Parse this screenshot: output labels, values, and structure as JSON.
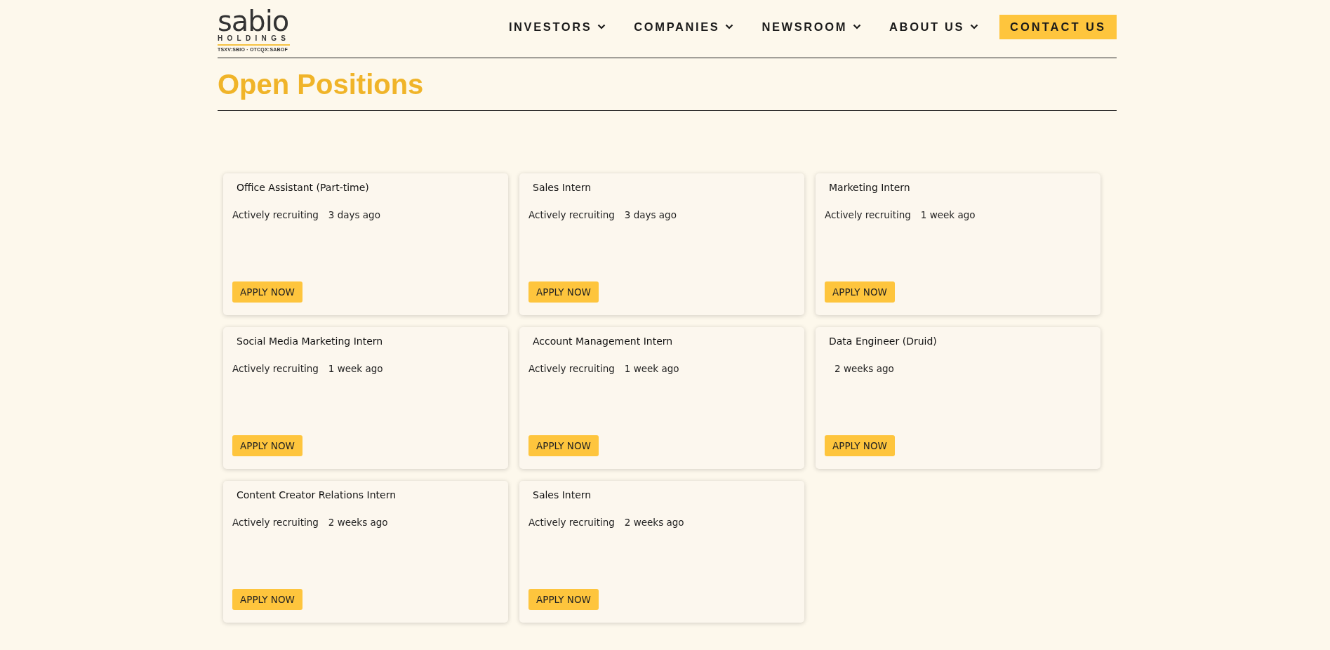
{
  "logo": {
    "name": "sabio",
    "sub": "HOLDINGS",
    "tickers": "TSXV:SBIO · OTCQX:SABOF"
  },
  "nav": [
    {
      "label": "INVESTORS",
      "kind": "dropdown"
    },
    {
      "label": "COMPANIES",
      "kind": "dropdown"
    },
    {
      "label": "NEWSROOM",
      "kind": "dropdown"
    },
    {
      "label": "ABOUT US",
      "kind": "dropdown"
    },
    {
      "label": "CONTACT US",
      "kind": "cta"
    }
  ],
  "page_title": "Open Positions",
  "jobs": [
    {
      "title": "Office Assistant (Part-time)",
      "status": "Actively recruiting",
      "posted": "3 days ago",
      "button": "APPLY NOW"
    },
    {
      "title": "Sales Intern",
      "status": "Actively recruiting",
      "posted": "3 days ago",
      "button": "APPLY NOW"
    },
    {
      "title": "Marketing Intern",
      "status": "Actively recruiting",
      "posted": "1 week ago",
      "button": "APPLY NOW"
    },
    {
      "title": "Social Media Marketing Intern",
      "status": "Actively recruiting",
      "posted": "1 week ago",
      "button": "APPLY NOW"
    },
    {
      "title": "Account Management Intern",
      "status": "Actively recruiting",
      "posted": "1 week ago",
      "button": "APPLY NOW"
    },
    {
      "title": "Data Engineer (Druid)",
      "posted": "2 weeks ago",
      "button": "APPLY NOW"
    },
    {
      "title": "Content Creator Relations Intern",
      "status": "Actively recruiting",
      "posted": "2 weeks ago",
      "button": "APPLY NOW"
    },
    {
      "title": "Sales Intern",
      "status": "Actively recruiting",
      "posted": "2 weeks ago",
      "button": "APPLY NOW"
    }
  ]
}
